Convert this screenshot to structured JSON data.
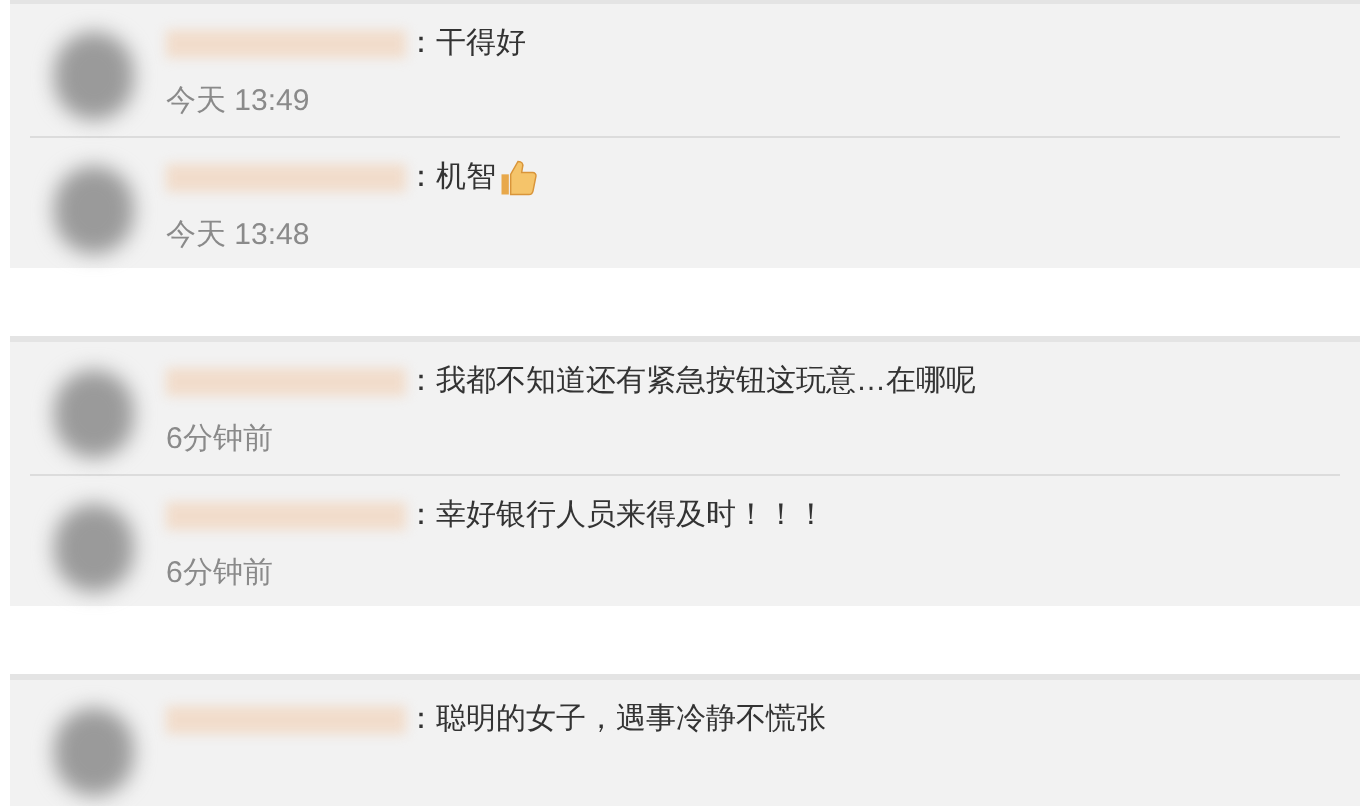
{
  "comment_groups": [
    {
      "comments": [
        {
          "text": "：干得好",
          "time": "今天 13:49"
        },
        {
          "text": "：机智",
          "thumbs_up_emoji": true,
          "time": "今天 13:48"
        }
      ]
    },
    {
      "comments": [
        {
          "text": "：我都不知道还有紧急按钮这玩意…在哪呢",
          "time": "6分钟前"
        },
        {
          "text": "：幸好银行人员来得及时！！！",
          "time": "6分钟前"
        }
      ]
    },
    {
      "comments": [
        {
          "text": "：聪明的女子，遇事冷静不慌张"
        }
      ]
    }
  ]
}
